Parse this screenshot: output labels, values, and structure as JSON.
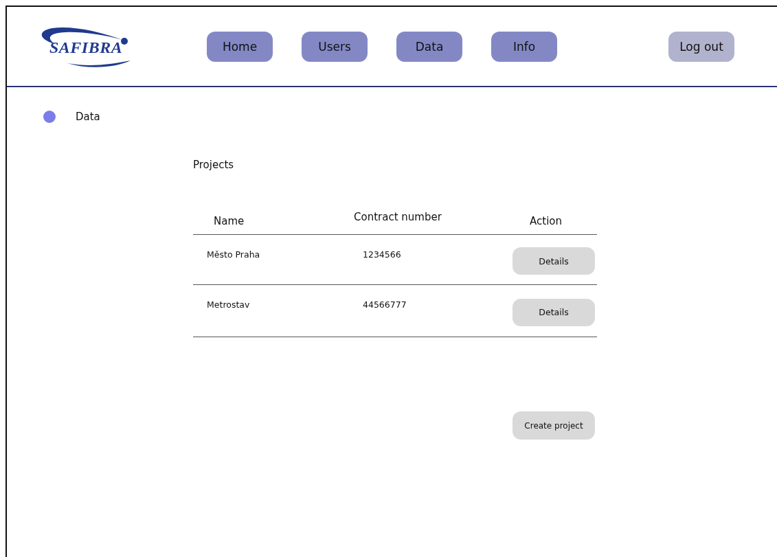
{
  "logo": {
    "text": "SAFIBRA"
  },
  "nav": [
    {
      "label": "Home",
      "kind": "page"
    },
    {
      "label": "Users",
      "kind": "page"
    },
    {
      "label": "Data",
      "kind": "page"
    },
    {
      "label": "Info",
      "kind": "page"
    },
    {
      "label": "Log out",
      "kind": "logout"
    }
  ],
  "breadcrumb": {
    "label": "Data"
  },
  "section_title": "Projects",
  "table": {
    "columns": [
      "Name",
      "Contract number",
      "Action"
    ],
    "rows": [
      {
        "name": "Město Praha",
        "contract_number": "1234566",
        "action": "Details"
      },
      {
        "name": "Metrostav",
        "contract_number": "44566777",
        "action": "Details"
      }
    ]
  },
  "create_button": "Create project"
}
